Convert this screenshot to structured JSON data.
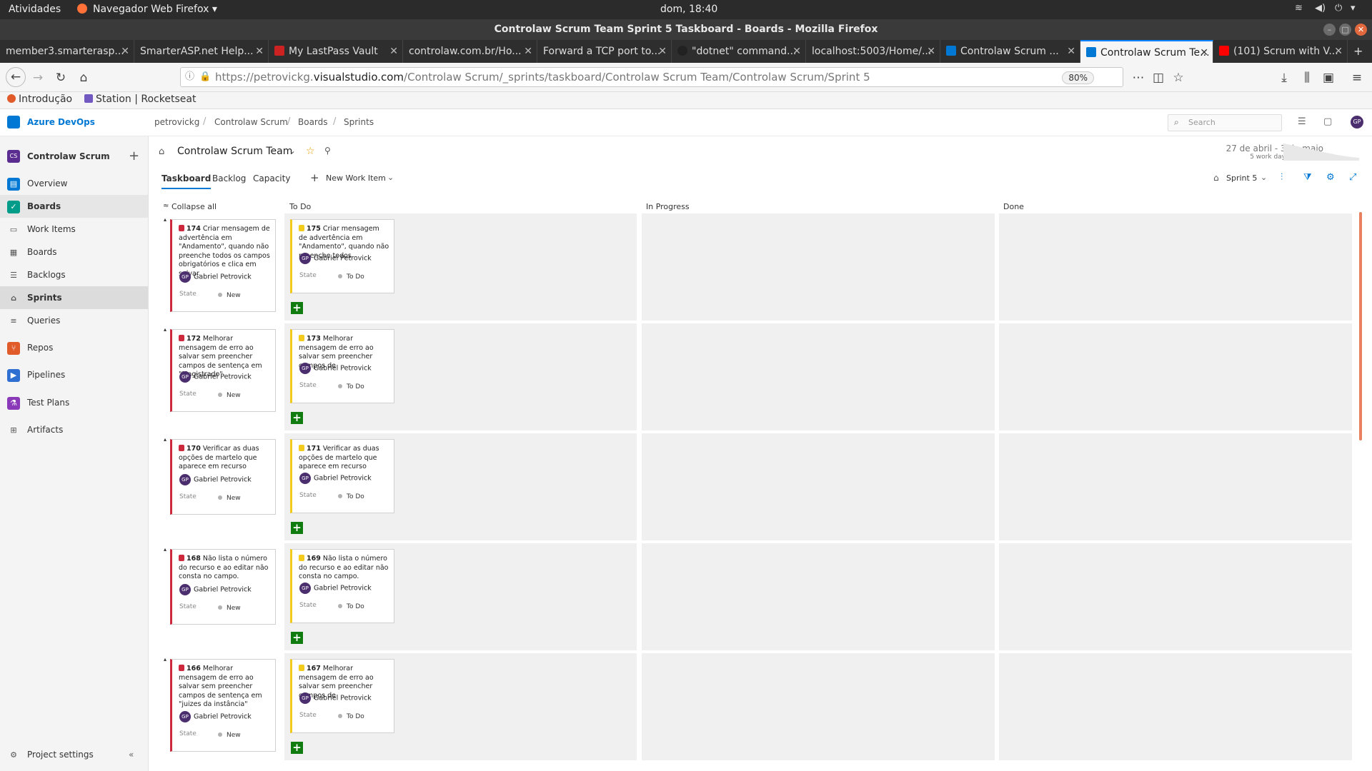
{
  "ubuntu_bar": {
    "activities": "Atividades",
    "app_menu": "Navegador Web Firefox ▾",
    "clock": "dom, 18:40"
  },
  "window": {
    "title": "Controlaw Scrum Team Sprint 5 Taskboard - Boards - Mozilla Firefox"
  },
  "tabs": [
    {
      "label": "member3.smarterasp...",
      "fav_color": "#e05a2a"
    },
    {
      "label": "SmarterASP.net Help...",
      "fav_color": "#4caf50"
    },
    {
      "label": "My LastPass Vault",
      "fav_color": "#cc2222"
    },
    {
      "label": "controlaw.com.br/Ho...",
      "fav_color": "#888888"
    },
    {
      "label": "Forward a TCP port to...",
      "fav_color": "#888888"
    },
    {
      "label": "\"dotnet\" command...",
      "fav_color": "#222222"
    },
    {
      "label": "localhost:5003/Home/...",
      "fav_color": "#888888"
    },
    {
      "label": "Controlaw Scrum ...",
      "fav_color": "#0078d4"
    },
    {
      "label": "Controlaw Scrum Te...",
      "fav_color": "#0078d4"
    },
    {
      "label": "(101) Scrum with V...",
      "fav_color": "#ff0000"
    }
  ],
  "urlbar": {
    "scheme": "https://",
    "host_prefix": "petrovickg.",
    "host": "visualstudio.com",
    "path": "/Controlaw Scrum/_sprints/taskboard/Controlaw Scrum Team/Controlaw Scrum/Sprint 5",
    "zoom": "80%"
  },
  "bookmarks": [
    "Introdução",
    "Station | Rocketseat"
  ],
  "ado": {
    "brand": "Azure DevOps",
    "breadcrumb": [
      "petrovickg",
      "Controlaw Scrum",
      "Boards",
      "Sprints"
    ],
    "search_placeholder": "Search",
    "user_initials": "GP"
  },
  "sidebar": {
    "project_badge": "CS",
    "project_name": "Controlaw Scrum",
    "items": [
      {
        "label": "Overview"
      },
      {
        "label": "Boards"
      },
      {
        "label": "Work Items"
      },
      {
        "label": "Boards"
      },
      {
        "label": "Backlogs"
      },
      {
        "label": "Sprints"
      },
      {
        "label": "Queries"
      },
      {
        "label": "Repos"
      },
      {
        "label": "Pipelines"
      },
      {
        "label": "Test Plans"
      },
      {
        "label": "Artifacts"
      }
    ],
    "settings": "Project settings"
  },
  "page": {
    "team_name": "Controlaw Scrum Team",
    "date_range": "27 de abril - 3 de maio",
    "days_remaining": "5 work days remaining",
    "tabs": [
      "Taskboard",
      "Backlog",
      "Capacity"
    ],
    "new_work_item": "New Work Item",
    "sprint_picker": "Sprint 5",
    "collapse_all": "Collapse all",
    "columns": [
      "To Do",
      "In Progress",
      "Done"
    ]
  },
  "lanes": [
    {
      "bug": {
        "id": "174",
        "title": "Criar mensagem de advertência em \"Andamento\", quando não preenche todos os campos obrigatórios e clica em salvar.",
        "assignee": "Gabriel Petrovick",
        "state_label": "State",
        "state": "New"
      },
      "task": {
        "id": "175",
        "title": "Criar mensagem de advertência em \"Andamento\", quando não preenche todos",
        "assignee": "Gabriel Petrovick",
        "state_label": "State",
        "state": "To Do"
      }
    },
    {
      "bug": {
        "id": "172",
        "title": "Melhorar mensagem de erro ao salvar sem preencher campos de sentença em \"Magistrado\"",
        "assignee": "Gabriel Petrovick",
        "state_label": "State",
        "state": "New"
      },
      "task": {
        "id": "173",
        "title": "Melhorar mensagem de erro ao salvar sem preencher campos de",
        "assignee": "Gabriel Petrovick",
        "state_label": "State",
        "state": "To Do"
      }
    },
    {
      "bug": {
        "id": "170",
        "title": "Verificar as duas opções de martelo que aparece em recurso",
        "assignee": "Gabriel Petrovick",
        "state_label": "State",
        "state": "New"
      },
      "task": {
        "id": "171",
        "title": "Verificar as duas opções de martelo que aparece em recurso",
        "assignee": "Gabriel Petrovick",
        "state_label": "State",
        "state": "To Do"
      }
    },
    {
      "bug": {
        "id": "168",
        "title": "Não lista o número do recurso e ao editar não consta no campo.",
        "assignee": "Gabriel Petrovick",
        "state_label": "State",
        "state": "New"
      },
      "task": {
        "id": "169",
        "title": "Não lista o número do recurso e ao editar não consta no campo.",
        "assignee": "Gabriel Petrovick",
        "state_label": "State",
        "state": "To Do"
      }
    },
    {
      "bug": {
        "id": "166",
        "title": "Melhorar mensagem de erro ao salvar sem preencher campos de sentença em \"juizes da instância\"",
        "assignee": "Gabriel Petrovick",
        "state_label": "State",
        "state": "New"
      },
      "task": {
        "id": "167",
        "title": "Melhorar mensagem de erro ao salvar sem preencher campos de",
        "assignee": "Gabriel Petrovick",
        "state_label": "State",
        "state": "To Do"
      }
    }
  ]
}
